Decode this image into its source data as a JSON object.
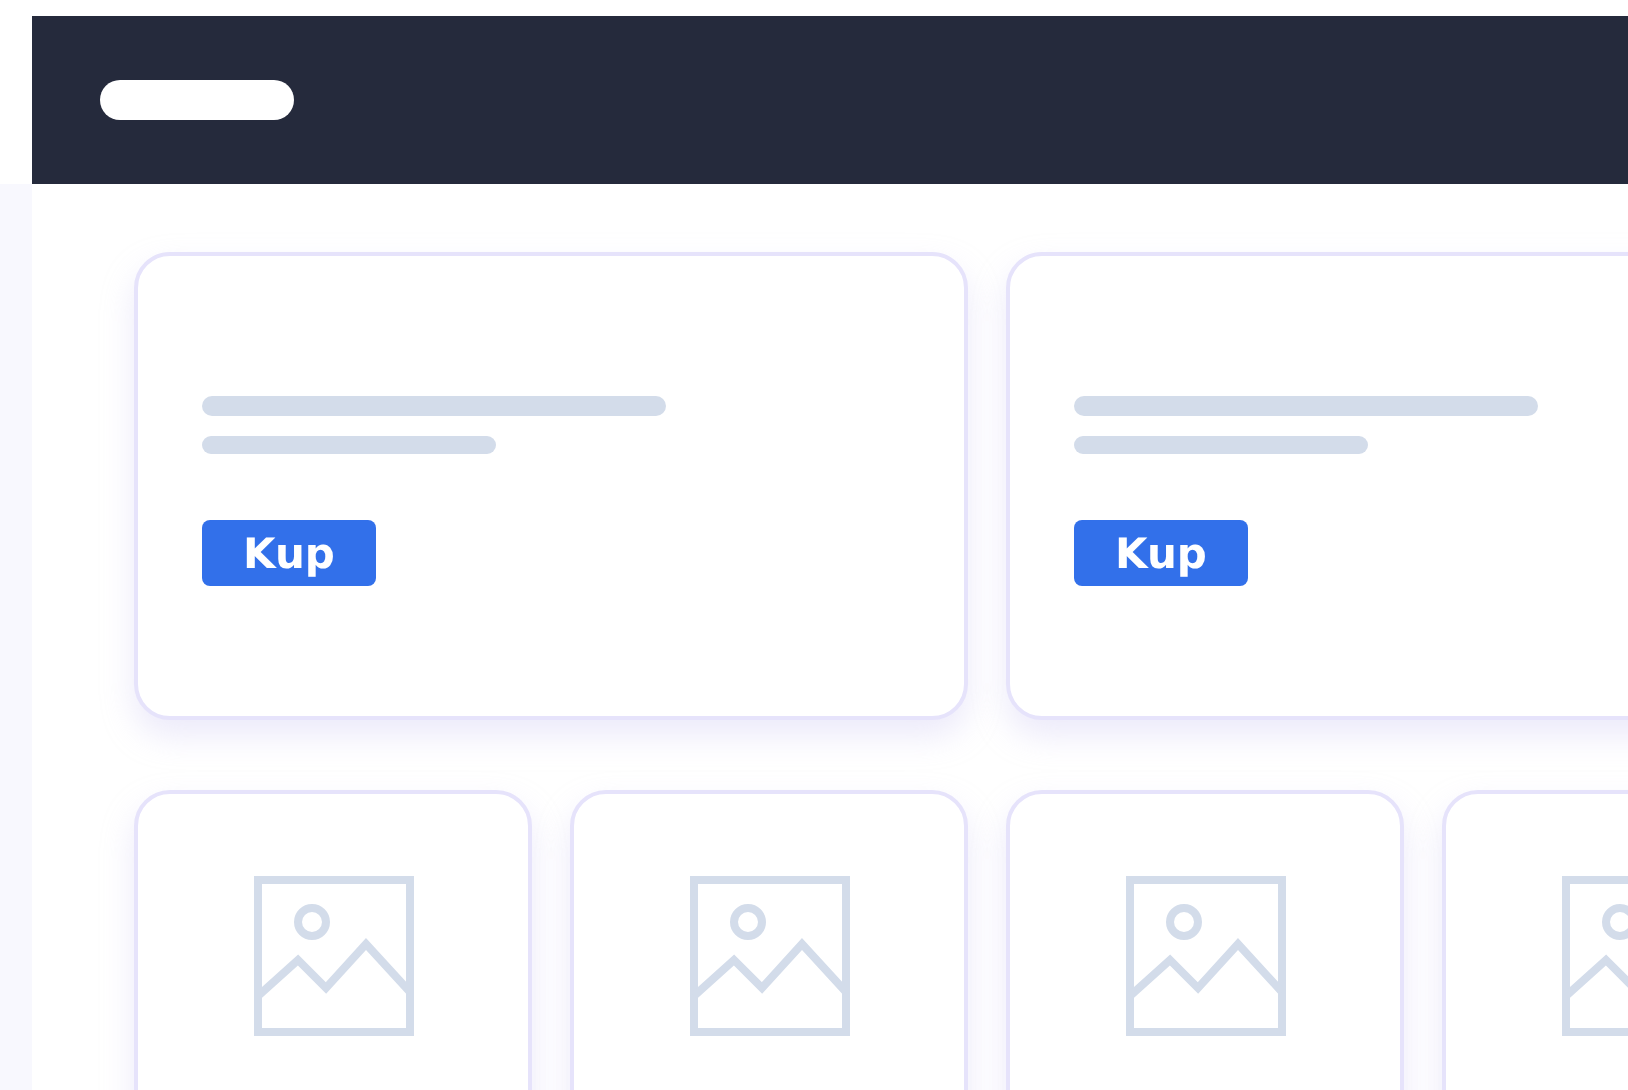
{
  "promo_cards": [
    {
      "button": "Kup"
    },
    {
      "button": "Kup"
    }
  ],
  "thumb_cards": [
    {
      "kind": "image-placeholder"
    },
    {
      "kind": "image-placeholder"
    },
    {
      "kind": "image-placeholder"
    },
    {
      "kind": "image-placeholder"
    }
  ]
}
